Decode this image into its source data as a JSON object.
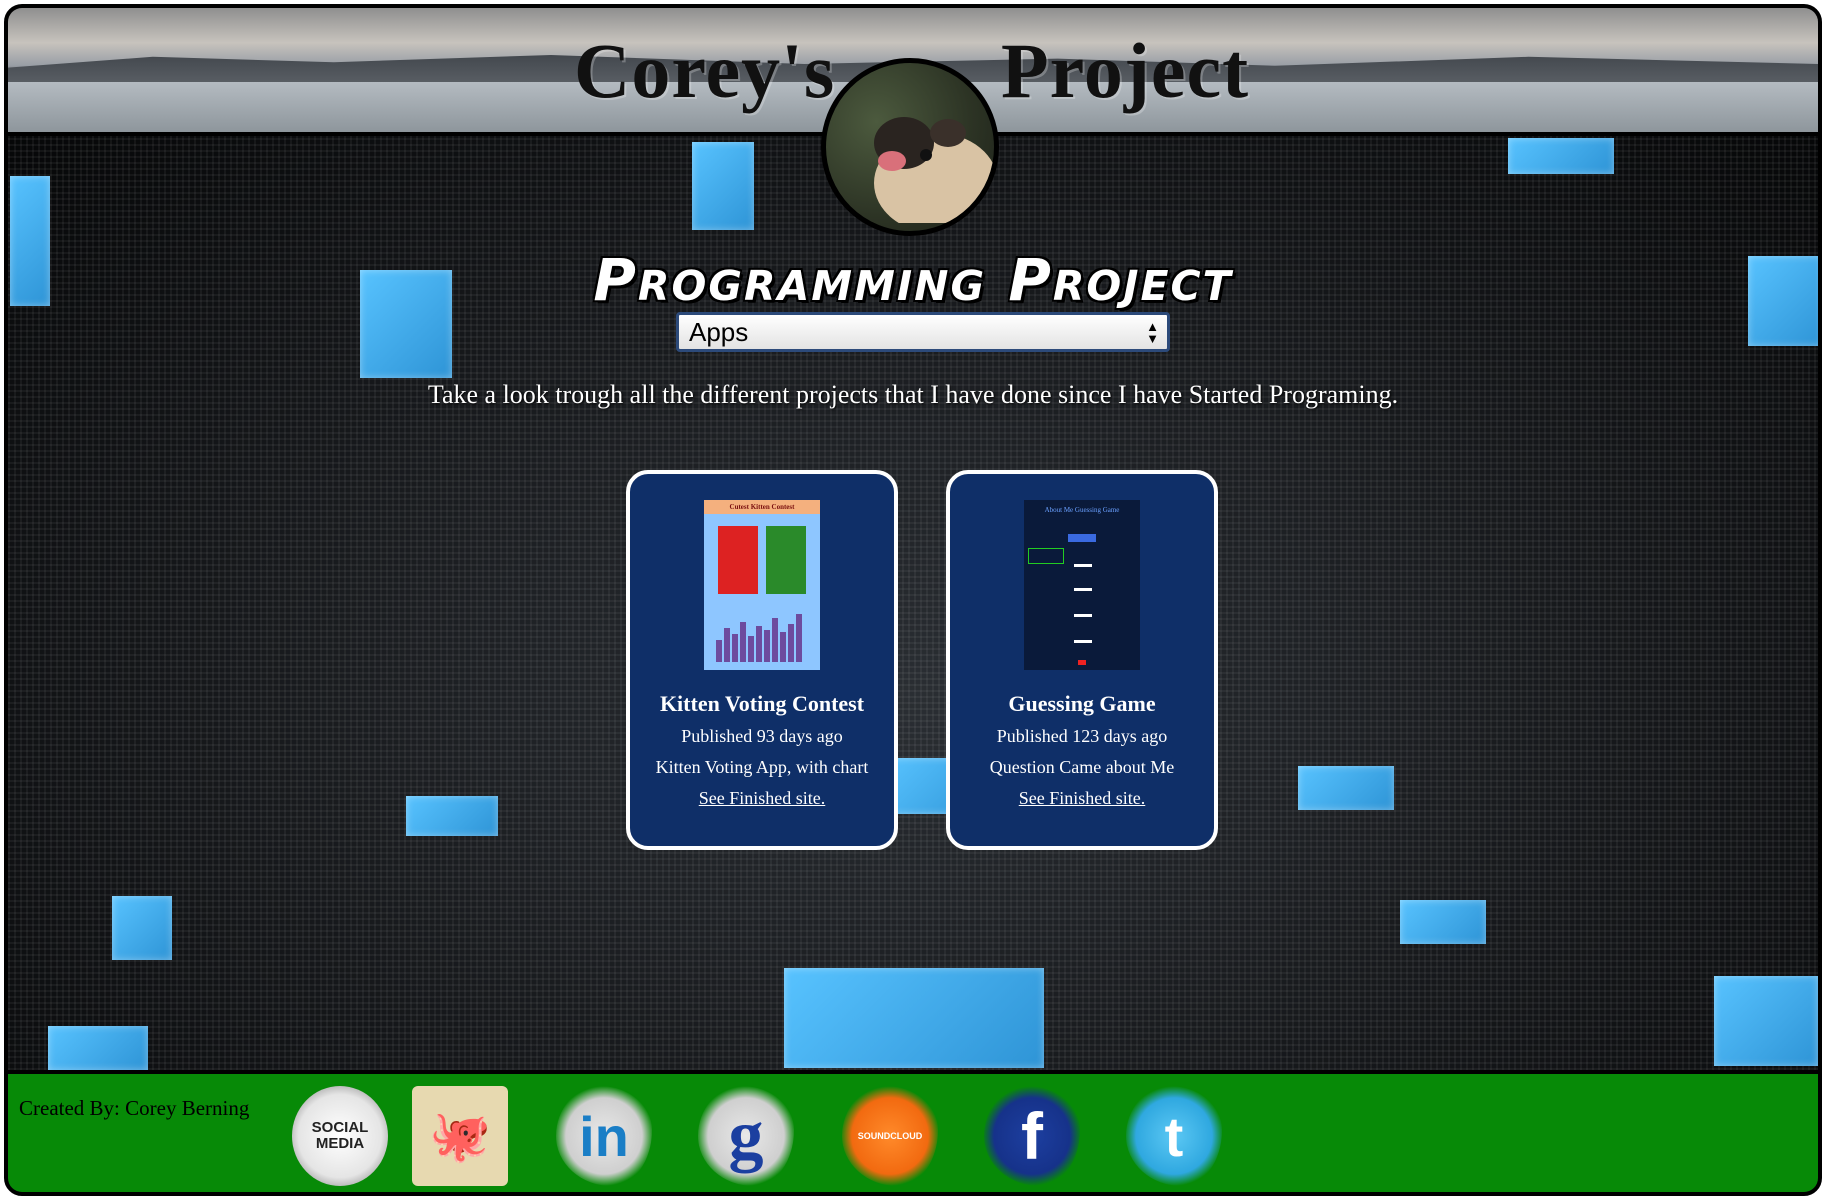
{
  "header": {
    "title_left": "Corey's",
    "title_right": "Project"
  },
  "main": {
    "subtitle": "Programming Project",
    "category_select": {
      "selected": "Apps"
    },
    "intro": "Take a look trough all the different projects that I have done since I have Started Programing."
  },
  "projects": [
    {
      "title": "Kitten Voting Contest",
      "published": "Published 93 days ago",
      "description": "Kitten Voting App, with chart",
      "link_text": "See Finished site.",
      "thumb_heading": "Cutest Kitten Contest"
    },
    {
      "title": "Guessing Game",
      "published": "Published 123 days ago",
      "description": "Question Came about Me",
      "link_text": "See Finished site.",
      "thumb_heading": "About Me Guessing Game"
    }
  ],
  "footer": {
    "credit": "Created By: Corey Berning",
    "social_links": [
      {
        "name": "social-media-icon",
        "glyph": "SOCIAL MEDIA"
      },
      {
        "name": "github-octocat-icon",
        "glyph": "🐙"
      },
      {
        "name": "linkedin-icon",
        "glyph": "in"
      },
      {
        "name": "google-icon",
        "glyph": "g"
      },
      {
        "name": "soundcloud-icon",
        "glyph": "SOUNDCLOUD"
      },
      {
        "name": "facebook-icon",
        "glyph": "f"
      },
      {
        "name": "twitter-icon",
        "glyph": "t"
      }
    ]
  },
  "colors": {
    "card_bg": "#0f2f68",
    "footer_bg": "#078a07",
    "accent_tile": "#3aa8ec"
  }
}
